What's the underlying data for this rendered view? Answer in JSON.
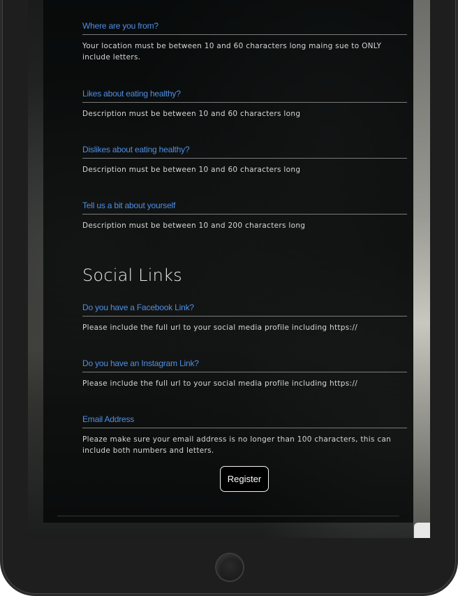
{
  "fields": [
    {
      "label": "Where are you from?",
      "help": "Your location must be between 10 and 60 characters long maing sue to ONLY include letters."
    },
    {
      "label": "Likes about eating healthy?",
      "help": "Description must be between 10 and 60 characters long"
    },
    {
      "label": "Dislikes about eating healthy?",
      "help": "Description must be between 10 and 60 characters long"
    },
    {
      "label": "Tell us a bit about yourself",
      "help": "Description must be between 10 and 200 characters long"
    }
  ],
  "social": {
    "heading": "Social Links",
    "fields": [
      {
        "label": "Do you have a Facebook Link?",
        "help": "Please include the full url to your social media profile including https://"
      },
      {
        "label": "Do you have an Instagram Link?",
        "help": "Please include the full url to your social media profile including https://"
      },
      {
        "label": "Email Address",
        "help": "Pleaze make sure your email address is no longer than 100 characters, this can include both numbers and letters."
      }
    ]
  },
  "register_label": "Register",
  "colors": {
    "label": "#4f8fe6",
    "panel": "#030506",
    "text": "#d6d6d6"
  },
  "icons": {
    "home": "home-button-icon"
  }
}
